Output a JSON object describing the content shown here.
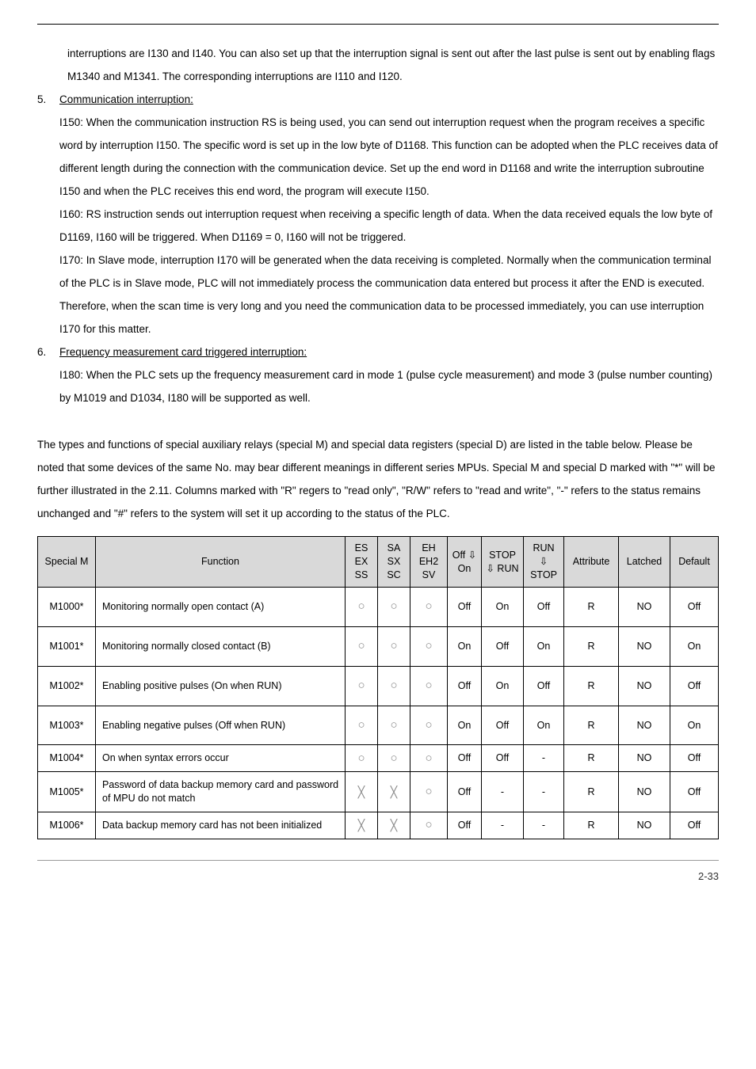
{
  "intro_cont": "interruptions are I130 and I140. You can also set up that the interruption signal is sent out after the last pulse is sent out by enabling flags M1340 and M1341. The corresponding interruptions are I110 and I120.",
  "item5": {
    "num": "5.",
    "title": "Communication interruption:",
    "p1": "I150: When the communication instruction RS is being used, you can send out interruption request when the program receives a specific word by interruption I150. The specific word is set up in the low byte of D1168. This function can be adopted when the PLC receives data of different length during the connection with the communication device. Set up the end word in D1168 and write the interruption subroutine I150 and when the PLC receives this end word, the program will execute I150.",
    "p2": "I160: RS instruction sends out interruption request when receiving a specific length of data. When the data received equals the low byte of D1169, I160 will be triggered. When D1169 = 0, I160 will not be triggered.",
    "p3": "I170: In Slave mode, interruption I170 will be generated when the data receiving is completed. Normally when the communication terminal of the PLC is in Slave mode, PLC will not immediately process the communication data entered but process it after the END is executed. Therefore, when the scan time is very long and you need the communication data to be processed immediately, you can use interruption I170 for this matter."
  },
  "item6": {
    "num": "6.",
    "title": "Frequency measurement card triggered interruption:",
    "p1": "I180: When the PLC sets up the frequency measurement card in mode 1 (pulse cycle measurement) and mode 3 (pulse number counting) by M1019 and D1034, I180 will be supported as well."
  },
  "explain": "The types and functions of special auxiliary relays (special M) and special data registers (special D) are listed in the table below. Please be noted that some devices of the same No. may bear different meanings in different series MPUs. Special M and special D marked with \"*\" will be further illustrated in the 2.11. Columns marked with \"R\" regers to \"read only\", \"R/W\" refers to \"read and write\", \"-\" refers to the status remains unchanged and \"#\" refers to the system will set it up according to the status of the PLC.",
  "headers": {
    "c1": "Special M",
    "c2": "Function",
    "c3": "ES EX SS",
    "c4": "SA SX SC",
    "c5": "EH EH2 SV",
    "c6": "Off ⇩ On",
    "c7": "STOP ⇩ RUN",
    "c8": "RUN ⇩ STOP",
    "c9": "Attribute",
    "c10": "Latched",
    "c11": "Default"
  },
  "rows": [
    {
      "id": "M1000*",
      "func": "Monitoring normally open contact (A)",
      "c3": "○",
      "c4": "○",
      "c5": "○",
      "c6": "Off",
      "c7": "On",
      "c8": "Off",
      "attr": "R",
      "lat": "NO",
      "def": "Off",
      "tight": false
    },
    {
      "id": "M1001*",
      "func": "Monitoring normally closed contact (B)",
      "c3": "○",
      "c4": "○",
      "c5": "○",
      "c6": "On",
      "c7": "Off",
      "c8": "On",
      "attr": "R",
      "lat": "NO",
      "def": "On",
      "tight": false
    },
    {
      "id": "M1002*",
      "func": "Enabling positive pulses (On when RUN)",
      "c3": "○",
      "c4": "○",
      "c5": "○",
      "c6": "Off",
      "c7": "On",
      "c8": "Off",
      "attr": "R",
      "lat": "NO",
      "def": "Off",
      "tight": false
    },
    {
      "id": "M1003*",
      "func": "Enabling negative pulses (Off when RUN)",
      "c3": "○",
      "c4": "○",
      "c5": "○",
      "c6": "On",
      "c7": "Off",
      "c8": "On",
      "attr": "R",
      "lat": "NO",
      "def": "On",
      "tight": false
    },
    {
      "id": "M1004*",
      "func": "On when syntax errors occur",
      "c3": "○",
      "c4": "○",
      "c5": "○",
      "c6": "Off",
      "c7": "Off",
      "c8": "-",
      "attr": "R",
      "lat": "NO",
      "def": "Off",
      "tight": true
    },
    {
      "id": "M1005*",
      "func": "Password of data backup memory card and password of MPU do not match",
      "c3": "╳",
      "c4": "╳",
      "c5": "○",
      "c6": "Off",
      "c7": "-",
      "c8": "-",
      "attr": "R",
      "lat": "NO",
      "def": "Off",
      "tight": true
    },
    {
      "id": "M1006*",
      "func": "Data backup memory card has not been initialized",
      "c3": "╳",
      "c4": "╳",
      "c5": "○",
      "c6": "Off",
      "c7": "-",
      "c8": "-",
      "attr": "R",
      "lat": "NO",
      "def": "Off",
      "tight": true
    }
  ],
  "pageno": "2-33"
}
